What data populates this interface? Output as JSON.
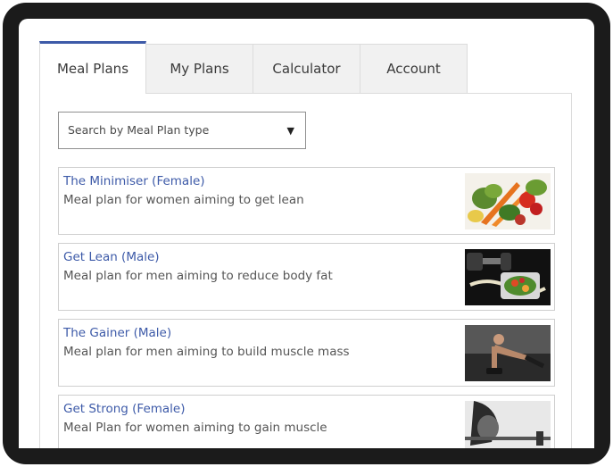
{
  "tabs": [
    {
      "label": "Meal Plans",
      "active": true
    },
    {
      "label": "My Plans",
      "active": false
    },
    {
      "label": "Calculator",
      "active": false
    },
    {
      "label": "Account",
      "active": false
    }
  ],
  "search": {
    "label": "Search by Meal Plan type",
    "arrow": "▼"
  },
  "plans": [
    {
      "title": "The Minimiser (Female)",
      "description": "Meal plan for women aiming to get lean",
      "image": "vegetables-photo"
    },
    {
      "title": "Get Lean (Male)",
      "description": "Meal plan for men aiming to reduce body fat",
      "image": "dumbbells-salad-photo"
    },
    {
      "title": "The Gainer (Male)",
      "description": "Meal plan for men aiming to build muscle mass",
      "image": "workout-pushup-photo"
    },
    {
      "title": "Get Strong (Female)",
      "description": "Meal Plan for women aiming to gain muscle",
      "image": "barbell-lift-photo"
    }
  ],
  "colors": {
    "accent": "#3d5aa8",
    "frame": "#1b1b1b",
    "tab_bg": "#f1f1f1"
  }
}
